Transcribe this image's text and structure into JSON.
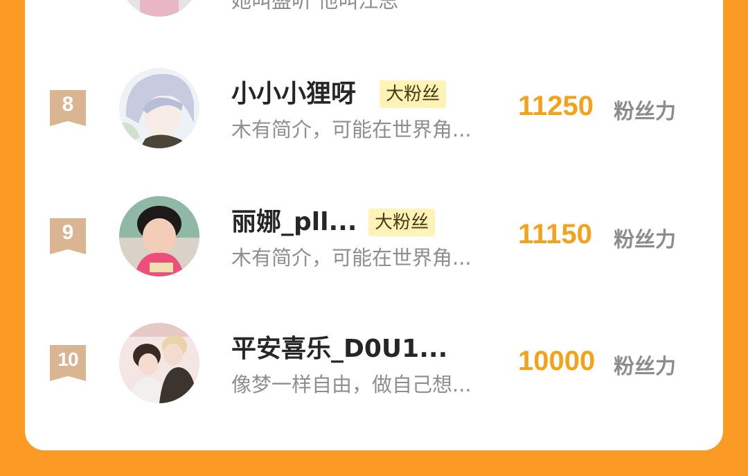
{
  "ranking": {
    "entries": [
      {
        "rank": "8",
        "name": "小小小狸呀",
        "badge": "大粉丝",
        "bio": "木有简介，可能在世界角...",
        "score": "11250",
        "unit": "粉丝力",
        "avatar": "anime-boy-silver-hair"
      },
      {
        "rank": "9",
        "name": "丽娜_pll...",
        "badge": "大粉丝",
        "bio": "木有简介，可能在世界角...",
        "score": "11150",
        "unit": "粉丝力",
        "avatar": "girl-photo"
      },
      {
        "rank": "10",
        "name": "平安喜乐_D0U1...",
        "bio": "像梦一样自由，做自己想...",
        "score": "10000",
        "unit": "粉丝力",
        "avatar": "anime-couple"
      }
    ],
    "previous_bio_fragment": "她叫盛听 他叫江思"
  },
  "colors": {
    "background": "#fb9a24",
    "score": "#f5a21b",
    "badge_bg": "#fff3b8",
    "rank_ribbon": "#d9b591"
  }
}
